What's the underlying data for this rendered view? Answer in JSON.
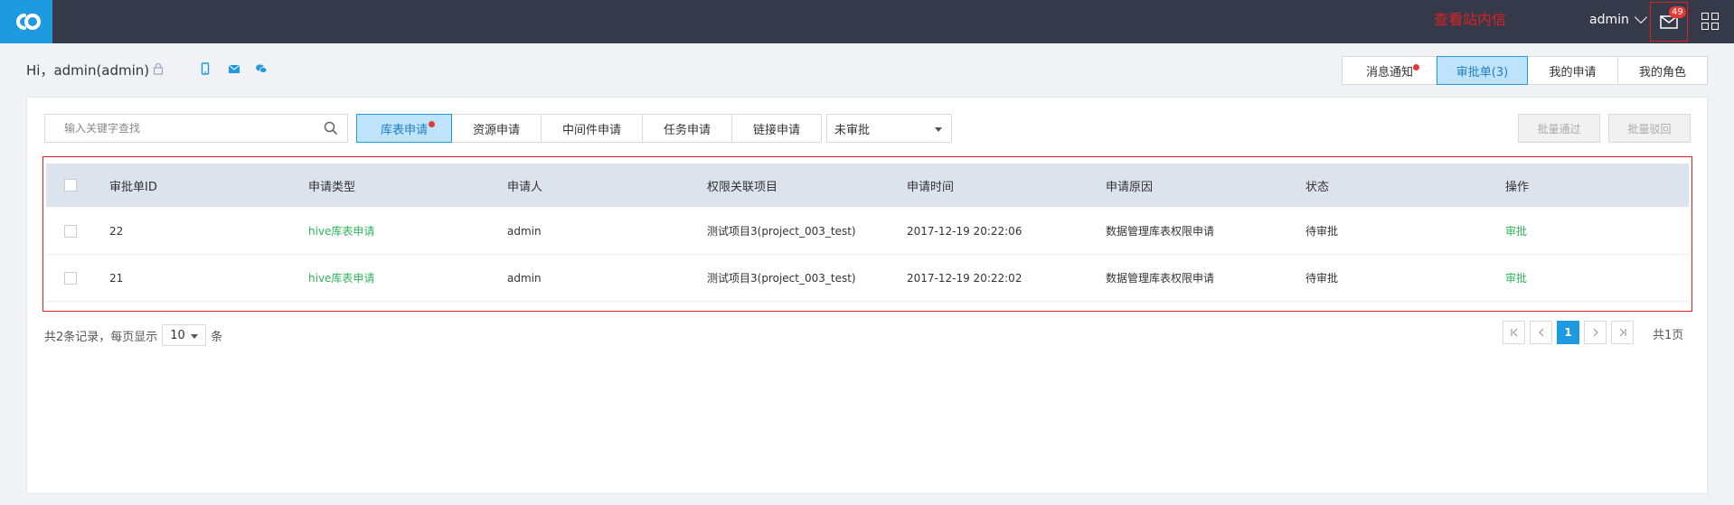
{
  "topbar": {
    "annotation": "查看站内信",
    "user": "admin",
    "mail_badge": "49"
  },
  "greeting": "Hi，admin(admin)",
  "right_tabs": [
    "消息通知",
    "审批单(3)",
    "我的申请",
    "我的角色"
  ],
  "search": {
    "placeholder": "输入关键字查找"
  },
  "filter_tabs": [
    "库表申请",
    "资源申请",
    "中间件申请",
    "任务申请",
    "链接申请"
  ],
  "status_select": "未审批",
  "batch_approve": "批量通过",
  "batch_reject": "批量驳回",
  "table": {
    "columns": [
      "审批单ID",
      "申请类型",
      "申请人",
      "权限关联项目",
      "申请时间",
      "申请原因",
      "状态",
      "操作"
    ],
    "rows": [
      [
        "22",
        "hive库表申请",
        "admin",
        "测试项目3(project_003_test)",
        "2017-12-19 20:22:06",
        "数据管理库表权限申请",
        "待审批",
        "审批"
      ],
      [
        "21",
        "hive库表申请",
        "admin",
        "测试项目3(project_003_test)",
        "2017-12-19 20:22:02",
        "数据管理库表权限申请",
        "待审批",
        "审批"
      ]
    ]
  },
  "footer": {
    "records_prefix": "共2条记录，每页显示",
    "page_size": "10",
    "records_suffix": "条",
    "current_page": "1",
    "total_pages": "共1页"
  },
  "colors": {
    "accent": "#1e9ae0",
    "topbar": "#353a4b",
    "alert": "#e02020",
    "link_green": "#2fb45a"
  }
}
